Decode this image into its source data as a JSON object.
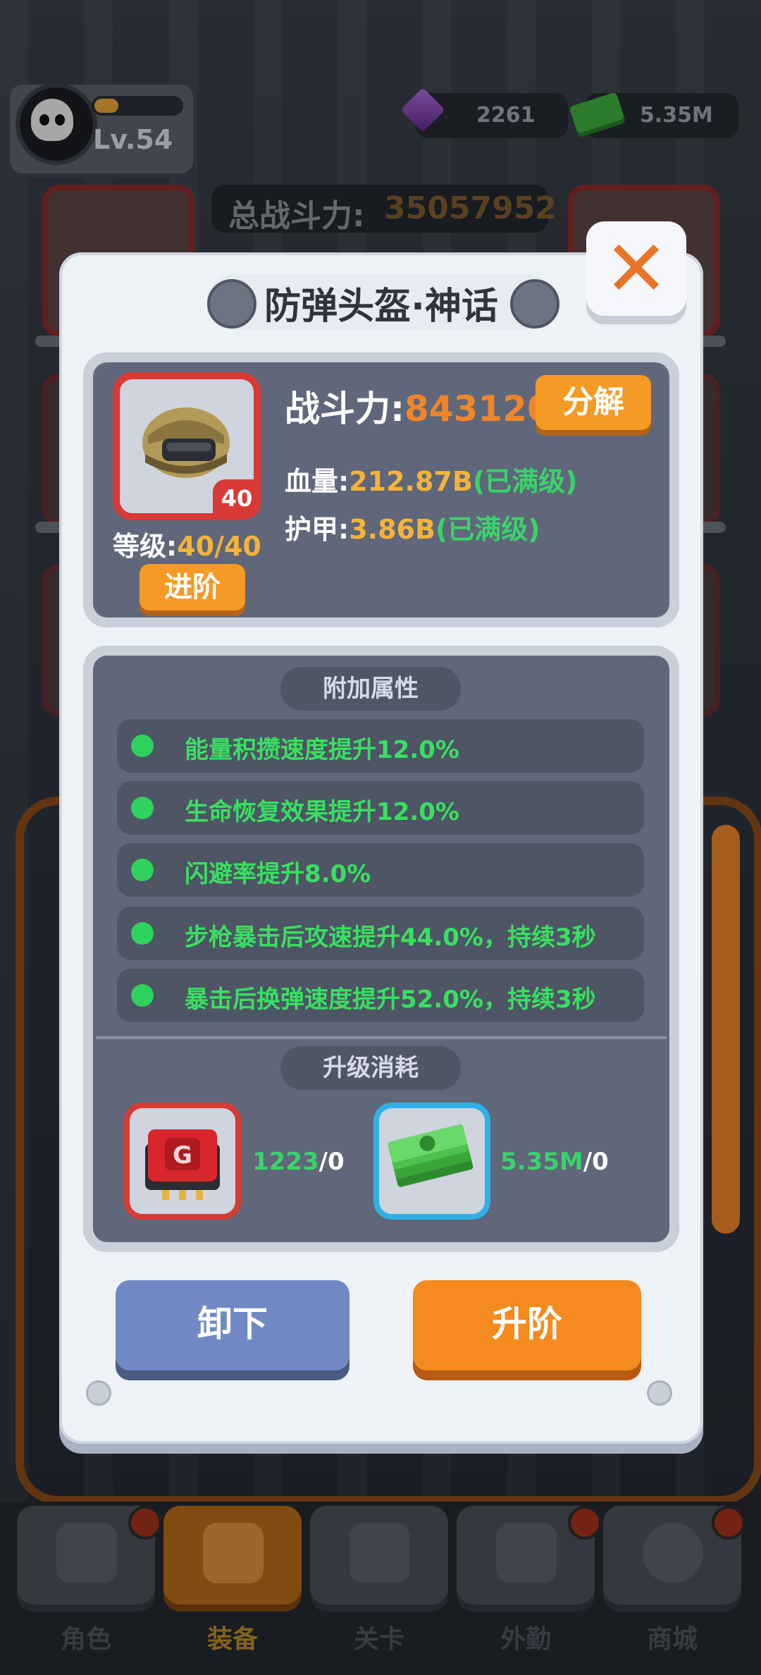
{
  "player": {
    "level": "Lv.54"
  },
  "resources": {
    "gems": "2261",
    "cash": "5.35M"
  },
  "total_power": {
    "label": "总战斗力:",
    "value": "35057952"
  },
  "modal": {
    "title": "防弹头盔·神话",
    "item_level_badge": "40",
    "grade_label": "等级:",
    "grade_value": "40/40",
    "advance_small_label": "进阶",
    "power_label": "战斗力:",
    "power_value": "843120",
    "decompose_label": "分解",
    "hp_label": "血量:",
    "hp_value": "212.87B",
    "hp_note": "(已满级)",
    "armor_label": "护甲:",
    "armor_value": "3.86B",
    "armor_note": "(已满级)",
    "attributes_title": "附加属性",
    "attributes": [
      "能量积攒速度提升12.0%",
      "生命恢复效果提升12.0%",
      "闪避率提升8.0%",
      "步枪暴击后攻速提升44.0%，持续3秒",
      "暴击后换弹速度提升52.0%，持续3秒"
    ],
    "upgrade_cost_title": "升级消耗",
    "costs": [
      {
        "have": "1223",
        "need": "/0",
        "icon": "chip-icon"
      },
      {
        "have": "5.35M",
        "need": "/0",
        "icon": "cash-icon"
      }
    ],
    "unequip_label": "卸下",
    "upgrade_label": "升阶"
  },
  "nav": {
    "items": [
      {
        "label": "角色",
        "icon": "skull-icon"
      },
      {
        "label": "装备",
        "icon": "gun-icon",
        "active": true
      },
      {
        "label": "关卡",
        "icon": "map-icon"
      },
      {
        "label": "外勤",
        "icon": "console-icon"
      },
      {
        "label": "商城",
        "icon": "shop-icon"
      }
    ]
  },
  "colors": {
    "accent_orange": "#f59a25",
    "rarity_red": "#d93a35",
    "attr_green": "#38e060",
    "value_yellow": "#f4b33a",
    "unequip_blue": "#7089c4"
  }
}
